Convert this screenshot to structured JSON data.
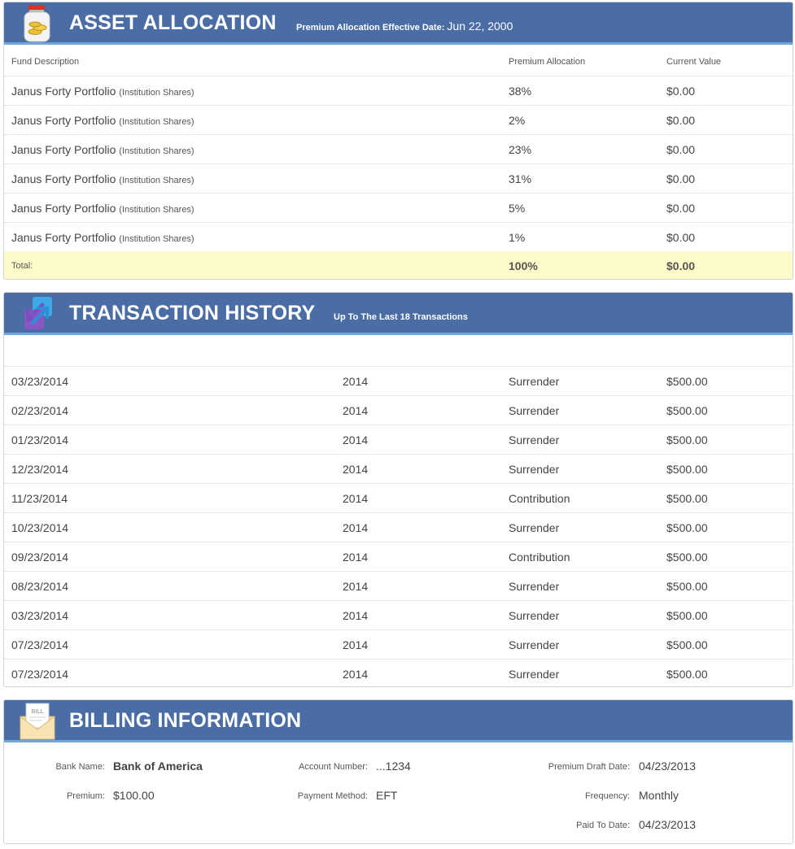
{
  "asset_allocation": {
    "title": "ASSET ALLOCATION",
    "subtitle_label": "Premium Allocation Effective Date:",
    "subtitle_date": "Jun 22, 2000",
    "icon": "coin-jar-icon",
    "columns": [
      "Fund Description",
      "Premium Allocation",
      "Current Value"
    ],
    "rows": [
      {
        "fund": "Janus Forty Portfolio",
        "share_class": "(Institution Shares)",
        "allocation": "38%",
        "value": "$0.00"
      },
      {
        "fund": "Janus Forty Portfolio",
        "share_class": "(Institution Shares)",
        "allocation": "2%",
        "value": "$0.00"
      },
      {
        "fund": "Janus Forty Portfolio",
        "share_class": "(Institution Shares)",
        "allocation": "23%",
        "value": "$0.00"
      },
      {
        "fund": "Janus Forty Portfolio",
        "share_class": "(Institution Shares)",
        "allocation": "31%",
        "value": "$0.00"
      },
      {
        "fund": "Janus Forty Portfolio",
        "share_class": "(Institution Shares)",
        "allocation": "5%",
        "value": "$0.00"
      },
      {
        "fund": "Janus Forty Portfolio",
        "share_class": "(Institution Shares)",
        "allocation": "1%",
        "value": "$0.00"
      }
    ],
    "total": {
      "label": "Total:",
      "allocation": "100%",
      "value": "$0.00"
    }
  },
  "transaction_history": {
    "title": "TRANSACTION HISTORY",
    "subtitle": "Up To The Last 18 Transactions",
    "icon": "transfer-arrows-icon",
    "rows": [
      {
        "date": "03/23/2014",
        "year": "2014",
        "type": "Surrender",
        "amount": "$500.00"
      },
      {
        "date": "02/23/2014",
        "year": "2014",
        "type": "Surrender",
        "amount": "$500.00"
      },
      {
        "date": "01/23/2014",
        "year": "2014",
        "type": "Surrender",
        "amount": "$500.00"
      },
      {
        "date": "12/23/2014",
        "year": "2014",
        "type": "Surrender",
        "amount": "$500.00"
      },
      {
        "date": "11/23/2014",
        "year": "2014",
        "type": "Contribution",
        "amount": "$500.00"
      },
      {
        "date": "10/23/2014",
        "year": "2014",
        "type": "Surrender",
        "amount": "$500.00"
      },
      {
        "date": "09/23/2014",
        "year": "2014",
        "type": "Contribution",
        "amount": "$500.00"
      },
      {
        "date": "08/23/2014",
        "year": "2014",
        "type": "Surrender",
        "amount": "$500.00"
      },
      {
        "date": "03/23/2014",
        "year": "2014",
        "type": "Surrender",
        "amount": "$500.00"
      },
      {
        "date": "07/23/2014",
        "year": "2014",
        "type": "Surrender",
        "amount": "$500.00"
      },
      {
        "date": "07/23/2014",
        "year": "2014",
        "type": "Surrender",
        "amount": "$500.00"
      }
    ]
  },
  "billing_information": {
    "title": "BILLING INFORMATION",
    "icon": "bill-envelope-icon",
    "icon_text": "BILL",
    "bank_name_label": "Bank Name:",
    "bank_name": "Bank of America",
    "premium_label": "Premium:",
    "premium": "$100.00",
    "account_number_label": "Account Number:",
    "account_number": "...1234",
    "payment_method_label": "Payment Method:",
    "payment_method": "EFT",
    "draft_date_label": "Premium Draft Date:",
    "draft_date": "04/23/2013",
    "frequency_label": "Frequency:",
    "frequency": "Monthly",
    "paid_to_date_label": "Paid To Date:",
    "paid_to_date": "04/23/2013"
  },
  "colors": {
    "header_bg": "#4a6da6",
    "header_accent": "#6ea6dd",
    "total_row_bg": "#fdfbc9"
  }
}
